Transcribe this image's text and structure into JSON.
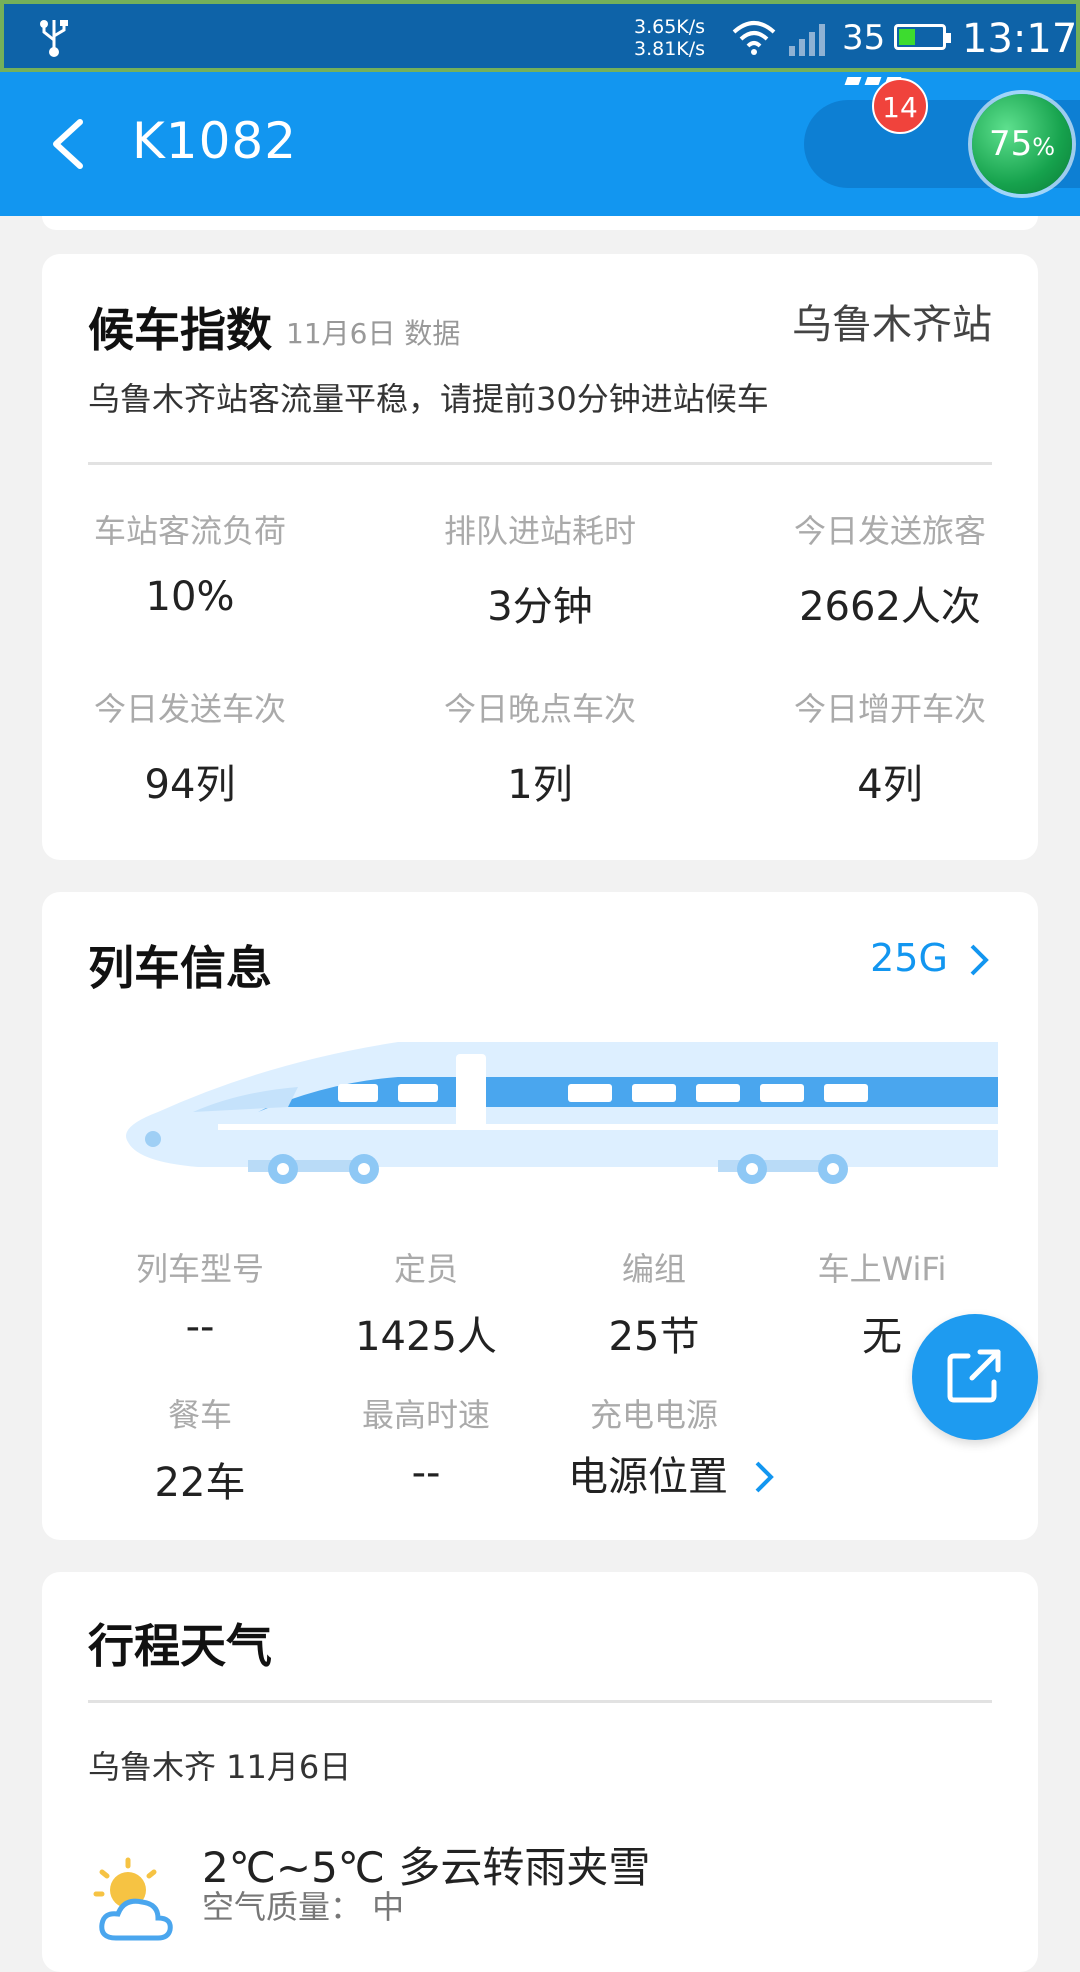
{
  "status_bar": {
    "speed_up": "3.65K/s",
    "speed_down": "3.81K/s",
    "battery_level": "35",
    "time": "13:17"
  },
  "header": {
    "title": "K1082",
    "badge_count": "14",
    "progress_value": "75",
    "progress_unit": "%"
  },
  "waiting_index": {
    "title": "候车指数",
    "date_note": "11月6日 数据",
    "station": "乌鲁木齐站",
    "notice": "乌鲁木齐站客流量平稳，请提前30分钟进站候车",
    "stats": [
      {
        "label": "车站客流负荷",
        "value": "10%"
      },
      {
        "label": "排队进站耗时",
        "value": "3分钟"
      },
      {
        "label": "今日发送旅客",
        "value": "2662人次"
      },
      {
        "label": "今日发送车次",
        "value": "94列"
      },
      {
        "label": "今日晚点车次",
        "value": "1列"
      },
      {
        "label": "今日增开车次",
        "value": "4列"
      }
    ]
  },
  "train_info": {
    "title": "列车信息",
    "link_text": "25G",
    "cells": [
      {
        "label": "列车型号",
        "value": "--"
      },
      {
        "label": "定员",
        "value": "1425人"
      },
      {
        "label": "编组",
        "value": "25节"
      },
      {
        "label": "车上WiFi",
        "value": "无"
      },
      {
        "label": "餐车",
        "value": "22车"
      },
      {
        "label": "最高时速",
        "value": "--"
      },
      {
        "label": "充电电源",
        "value": "电源位置"
      }
    ]
  },
  "weather": {
    "title": "行程天气",
    "city_date": "乌鲁木齐   11月6日",
    "temp_desc": "2℃~5℃ 多云转雨夹雪",
    "air_quality": "空气质量：  中"
  },
  "colors": {
    "header_blue": "#1296f0",
    "badge_red": "#f0433c",
    "link_blue": "#1296f0"
  }
}
